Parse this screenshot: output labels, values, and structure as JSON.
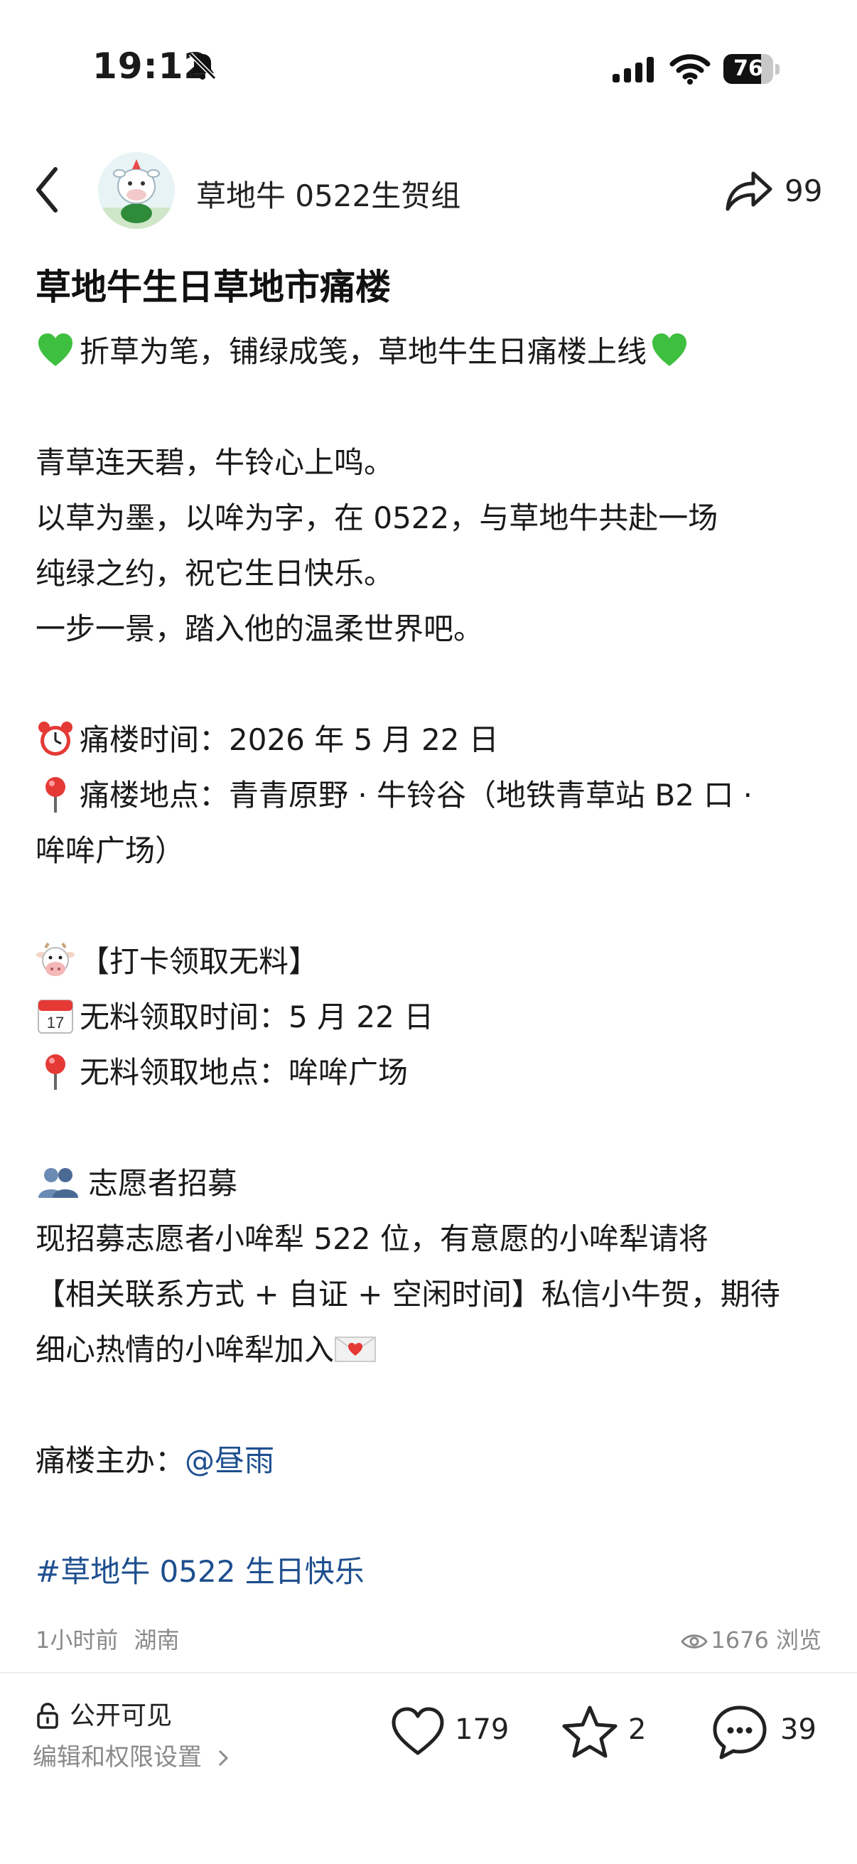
{
  "status_bar": {
    "time": "19:12",
    "battery_percent": "76",
    "battery_level": 0.76,
    "icons": [
      "bell-muted-icon",
      "cellular-signal-icon",
      "wifi-icon",
      "battery-icon"
    ]
  },
  "header": {
    "author": "草地牛 0522生贺组",
    "share_count": "99"
  },
  "post": {
    "title": "草地牛生日草地市痛楼",
    "lines": {
      "l1": "折草为笔，铺绿成笺，草地牛生日痛楼上线",
      "l2": "青草连天碧，牛铃心上鸣。",
      "l3": "以草为墨，以哞为字，在 0522，与草地牛共赴一场",
      "l4": "纯绿之约，祝它生日快乐。",
      "l5": "一步一景，踏入他的温柔世界吧。",
      "l6": "痛楼时间：2026 年 5 月 22 日",
      "l7": "痛楼地点：青青原野 · 牛铃谷（地铁青草站 B2 口 ·",
      "l8": "哞哞广场）",
      "l9": "【打卡领取无料】",
      "l10": "无料领取时间：5 月 22 日",
      "l11": "无料领取地点：哞哞广场",
      "l12": "志愿者招募",
      "l13": "现招募志愿者小哞犁 522 位，有意愿的小哞犁请将",
      "l14": "【相关联系方式 + 自证 + 空闲时间】私信小牛贺，期待",
      "l15": "细心热情的小哞犁加入",
      "l16_prefix": "痛楼主办：",
      "l16_mention": "@昼雨",
      "hashtag": "#草地牛 0522 生日快乐"
    },
    "emoji_icons": [
      "green-heart-icon",
      "alarm-clock-icon",
      "pin-icon",
      "cow-face-icon",
      "calendar-icon",
      "busts-icon",
      "love-letter-icon"
    ],
    "time_ago": "1小时前",
    "location": "湖南",
    "views": "1676 浏览"
  },
  "footer": {
    "visibility": "公开可见",
    "edit_settings": "编辑和权限设置",
    "likes": "179",
    "favorites": "2",
    "comments": "39"
  },
  "colors": {
    "link": "#1e4f8f",
    "meta_gray": "#8a8a8a",
    "emoji_green": "#3fbf3f"
  }
}
